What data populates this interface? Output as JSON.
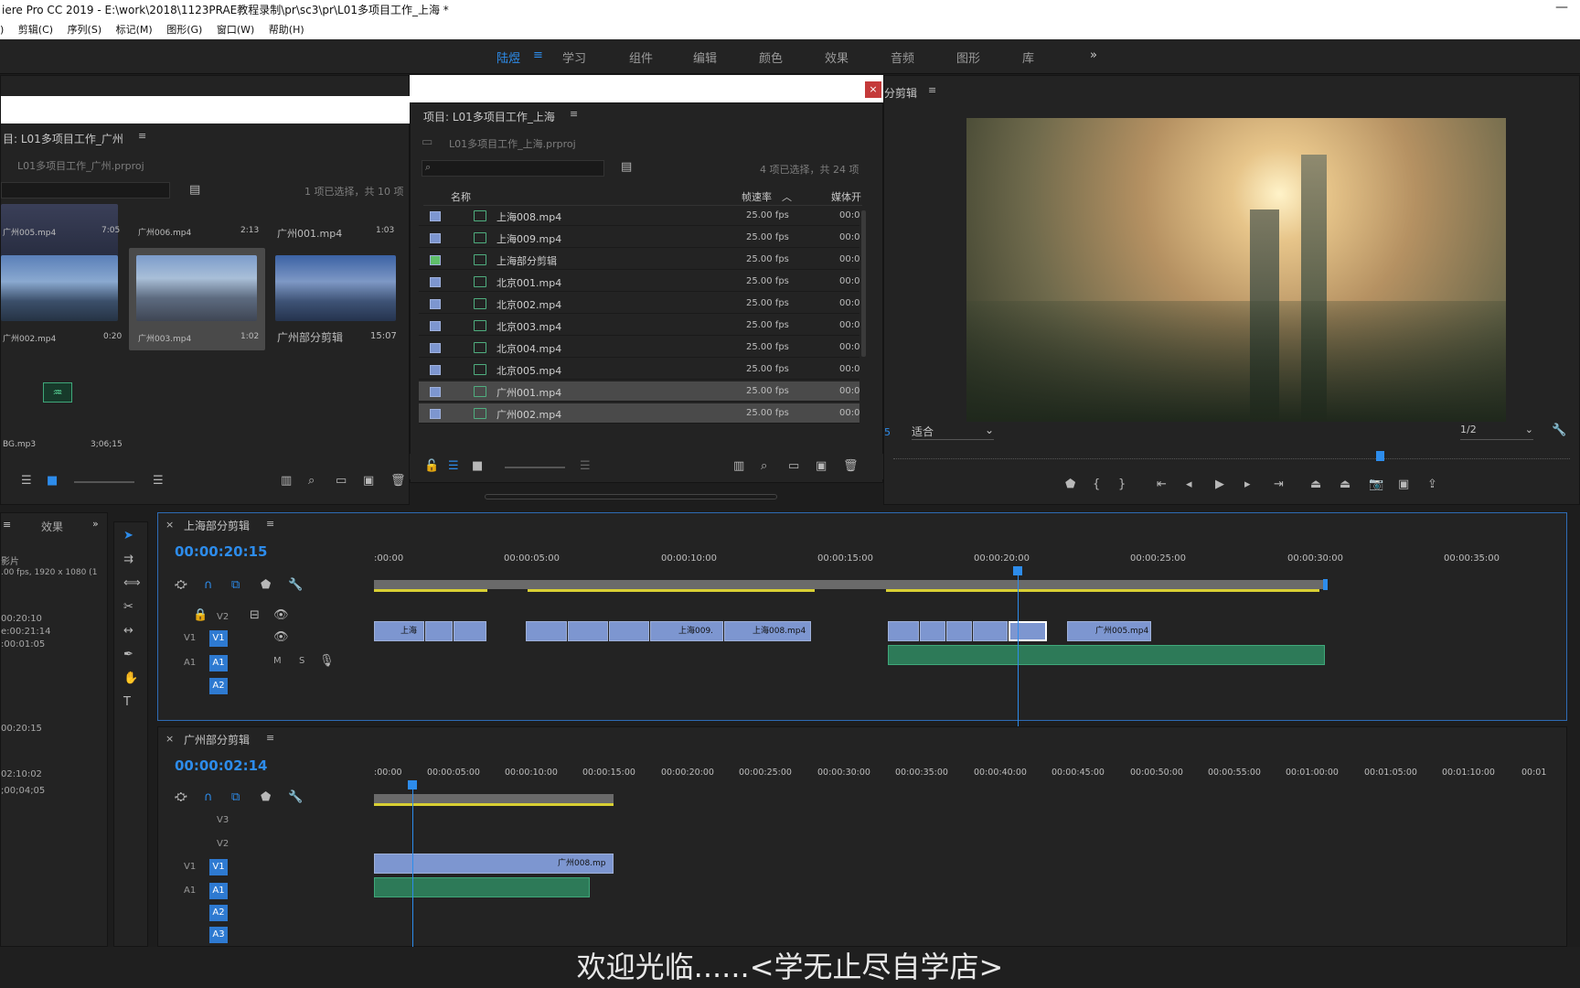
{
  "titlebar": {
    "title": "iere Pro CC 2019 - E:\\work\\2018\\1123PRAE教程录制\\pr\\sc3\\pr\\L01多项目工作_上海 *",
    "minimize": "—"
  },
  "menu": {
    "items": [
      ")",
      "剪辑(C)",
      "序列(S)",
      "标记(M)",
      "图形(G)",
      "窗口(W)",
      "帮助(H)"
    ]
  },
  "workspaces": {
    "items": [
      "陆煜",
      "学习",
      "组件",
      "编辑",
      "颜色",
      "效果",
      "音频",
      "图形",
      "库"
    ],
    "active": "陆煜",
    "more": "»"
  },
  "guangzhou_project": {
    "tab": "目: L01多项目工作_广州",
    "file": "L01多项目工作_广州.prproj",
    "selection": "1 项已选择，共 10 项",
    "items": [
      {
        "name": "广州005.mp4",
        "duration": "7:05"
      },
      {
        "name": "广州006.mp4",
        "duration": "2:13"
      },
      {
        "name": "广州001.mp4",
        "duration": "1:03"
      },
      {
        "name": "广州002.mp4",
        "duration": "0:20"
      },
      {
        "name": "广州003.mp4",
        "duration": "1:02"
      },
      {
        "name": "广州部分剪辑",
        "duration": "15:07"
      },
      {
        "name": "BG.mp3",
        "duration": "3;06;15"
      }
    ]
  },
  "shanghai_project": {
    "tab": "项目: L01多项目工作_上海",
    "file": "L01多项目工作_上海.prproj",
    "selection": "4 项已选择，共 24 项",
    "columns": {
      "name": "名称",
      "fps": "帧速率",
      "media": "媒体开"
    },
    "rows": [
      {
        "name": "上海008.mp4",
        "fps": "25.00 fps",
        "media": "00:0",
        "color": "#7d96d0"
      },
      {
        "name": "上海009.mp4",
        "fps": "25.00 fps",
        "media": "00:0",
        "color": "#7d96d0"
      },
      {
        "name": "上海部分剪辑",
        "fps": "25.00 fps",
        "media": "00:0",
        "color": "#5fbf6a"
      },
      {
        "name": "北京001.mp4",
        "fps": "25.00 fps",
        "media": "00:0",
        "color": "#7d96d0"
      },
      {
        "name": "北京002.mp4",
        "fps": "25.00 fps",
        "media": "00:0",
        "color": "#7d96d0"
      },
      {
        "name": "北京003.mp4",
        "fps": "25.00 fps",
        "media": "00:0",
        "color": "#7d96d0"
      },
      {
        "name": "北京004.mp4",
        "fps": "25.00 fps",
        "media": "00:0",
        "color": "#7d96d0"
      },
      {
        "name": "北京005.mp4",
        "fps": "25.00 fps",
        "media": "00:0",
        "color": "#7d96d0"
      },
      {
        "name": "广州001.mp4",
        "fps": "25.00 fps",
        "media": "00:0",
        "color": "#7d96d0"
      },
      {
        "name": "广州002.mp4",
        "fps": "25.00 fps",
        "media": "00:0",
        "color": "#7d96d0"
      }
    ]
  },
  "program_monitor": {
    "tab": "分剪辑",
    "fit": "适合",
    "resolution": "1/2",
    "left_num": "5"
  },
  "effects_panel": {
    "tab": "效果",
    "info_title": "影片",
    "info_spec": ".00 fps, 1920 x 1080 (1",
    "t1": "00:20:10",
    "t2": "e:00:21:14",
    "t3": ":00:01:05",
    "t4": "00:20:15",
    "t5": "02:10:02",
    "t6": ";00;04;05"
  },
  "seq1": {
    "tab": "上海部分剪辑",
    "timecode": "00:00:20:15",
    "ruler": [
      ":00:00",
      "00:00:05:00",
      "00:00:10:00",
      "00:00:15:00",
      "00:00:20:00",
      "00:00:25:00",
      "00:00:30:00",
      "00:00:35:00"
    ],
    "clips_v1": [
      "上海",
      "上海009.",
      "上海008.mp4",
      "广州005.mp4"
    ],
    "tracks": [
      "V2",
      "V1",
      "A1",
      "A2"
    ]
  },
  "seq2": {
    "tab": "广州部分剪辑",
    "timecode": "00:00:02:14",
    "ruler": [
      ":00:00",
      "00:00:05:00",
      "00:00:10:00",
      "00:00:15:00",
      "00:00:20:00",
      "00:00:25:00",
      "00:00:30:00",
      "00:00:35:00",
      "00:00:40:00",
      "00:00:45:00",
      "00:00:50:00",
      "00:00:55:00",
      "00:01:00:00",
      "00:01:05:00",
      "00:01:10:00",
      "00:01"
    ],
    "clips_v1": [
      "广州008.mp"
    ],
    "tracks": [
      "V3",
      "V2",
      "V1",
      "A1",
      "A2",
      "A3"
    ]
  },
  "subtitle": "欢迎光临......<学无止尽自学店>"
}
